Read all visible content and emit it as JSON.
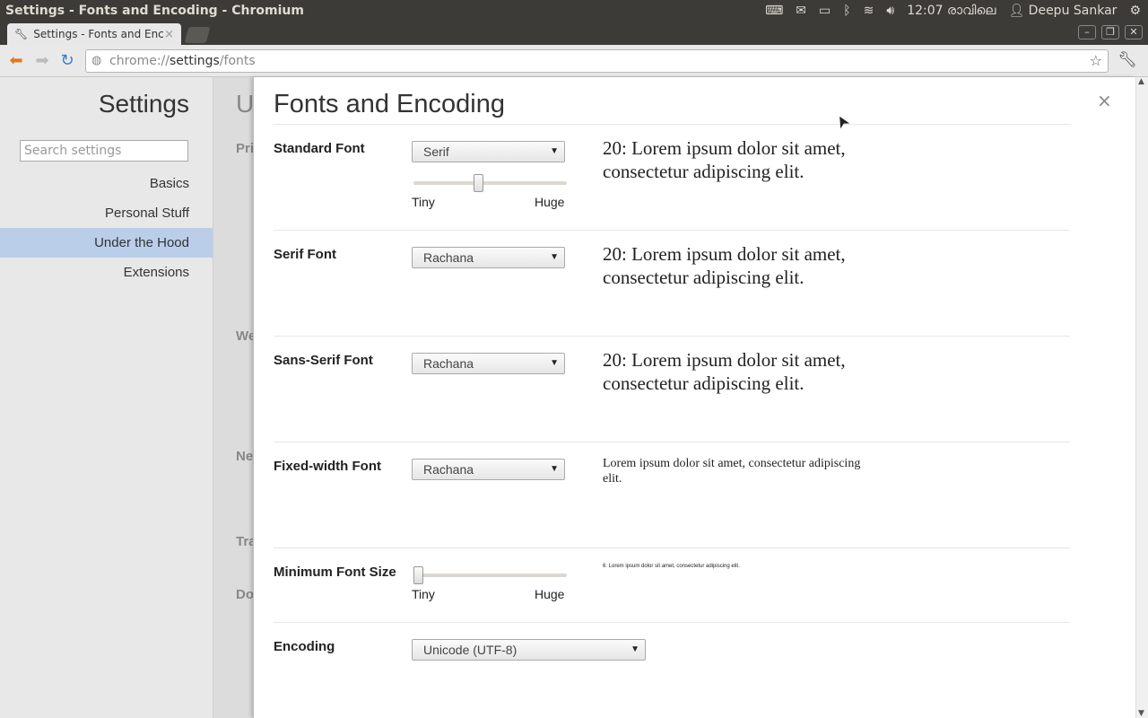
{
  "os_bar": {
    "window_title": "Settings - Fonts and Encoding - Chromium",
    "clock": "12:07 രാവിലെ",
    "user": "Deepu Sankar"
  },
  "tab": {
    "title": "Settings - Fonts and Encoc",
    "close": "×"
  },
  "toolbar": {
    "url_scheme": "chrome://",
    "url_host": "settings",
    "url_path": "/fonts"
  },
  "sidebar": {
    "title": "Settings",
    "search_placeholder": "Search settings",
    "items": [
      {
        "label": "Basics"
      },
      {
        "label": "Personal Stuff"
      },
      {
        "label": "Under the Hood"
      },
      {
        "label": "Extensions"
      }
    ]
  },
  "background_page": {
    "title_fragment": "U",
    "section_fragments": [
      "Pri",
      "We",
      "Ne",
      "Tra",
      "Do"
    ]
  },
  "dialog": {
    "title": "Fonts and Encoding",
    "close": "×",
    "standard_font": {
      "label": "Standard Font",
      "selected": "Serif",
      "slider_min": "Tiny",
      "slider_max": "Huge",
      "slider_level": 0.42,
      "preview": "20: Lorem ipsum dolor sit amet, consectetur adipiscing elit."
    },
    "serif_font": {
      "label": "Serif Font",
      "selected": "Rachana",
      "preview": "20: Lorem ipsum dolor sit amet, consectetur adipiscing elit."
    },
    "sans_serif_font": {
      "label": "Sans-Serif Font",
      "selected": "Rachana",
      "preview": "20: Lorem ipsum dolor sit amet, consectetur adipiscing elit."
    },
    "fixed_width_font": {
      "label": "Fixed-width Font",
      "selected": "Rachana",
      "preview": "Lorem ipsum dolor sit amet, consectetur adipiscing elit."
    },
    "minimum_font_size": {
      "label": "Minimum Font Size",
      "slider_min": "Tiny",
      "slider_max": "Huge",
      "slider_level": 0.0,
      "preview": "6: Lorem ipsum dolor sit amet, consectetur adipiscing elit."
    },
    "encoding": {
      "label": "Encoding",
      "selected": "Unicode (UTF-8)"
    }
  }
}
